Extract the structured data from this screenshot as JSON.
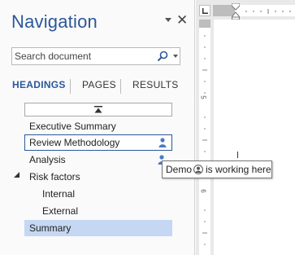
{
  "pane": {
    "title": "Navigation",
    "menu_icon": "dropdown-arrow-icon",
    "close_icon": "close-icon",
    "close_glyph": "✕"
  },
  "search": {
    "placeholder": "Search document",
    "icon": "magnifier-icon",
    "dropdown_icon": "chevron-down-icon"
  },
  "tabs": [
    {
      "label": "HEADINGS",
      "active": true
    },
    {
      "label": "PAGES",
      "active": false
    },
    {
      "label": "RESULTS",
      "active": false
    }
  ],
  "collapse_bar": {
    "icon": "collapse-up-icon"
  },
  "headings": [
    {
      "label": "Executive Summary",
      "level": 1,
      "state": "normal"
    },
    {
      "label": "Review Methodology",
      "level": 1,
      "state": "boxed",
      "icon": "person-icon"
    },
    {
      "label": "Analysis",
      "level": 1,
      "state": "normal",
      "icon": "person-icon"
    },
    {
      "label": "Risk factors",
      "level": 1,
      "state": "normal",
      "expander": "expanded-triangle-icon"
    },
    {
      "label": "Internal",
      "level": 2,
      "state": "normal"
    },
    {
      "label": "External",
      "level": 2,
      "state": "normal"
    },
    {
      "label": "Summary",
      "level": 1,
      "state": "selected"
    }
  ],
  "tooltip": {
    "before": "Demo",
    "icon": "user-avatar-icon",
    "after": "is working here"
  },
  "ruler": {
    "tab_stop_icon": "left-tab-stop-icon",
    "vertical_numbers": [
      "5",
      "6"
    ]
  },
  "colors": {
    "accent": "#2b579a",
    "selected_bg": "#c5d7f2"
  }
}
